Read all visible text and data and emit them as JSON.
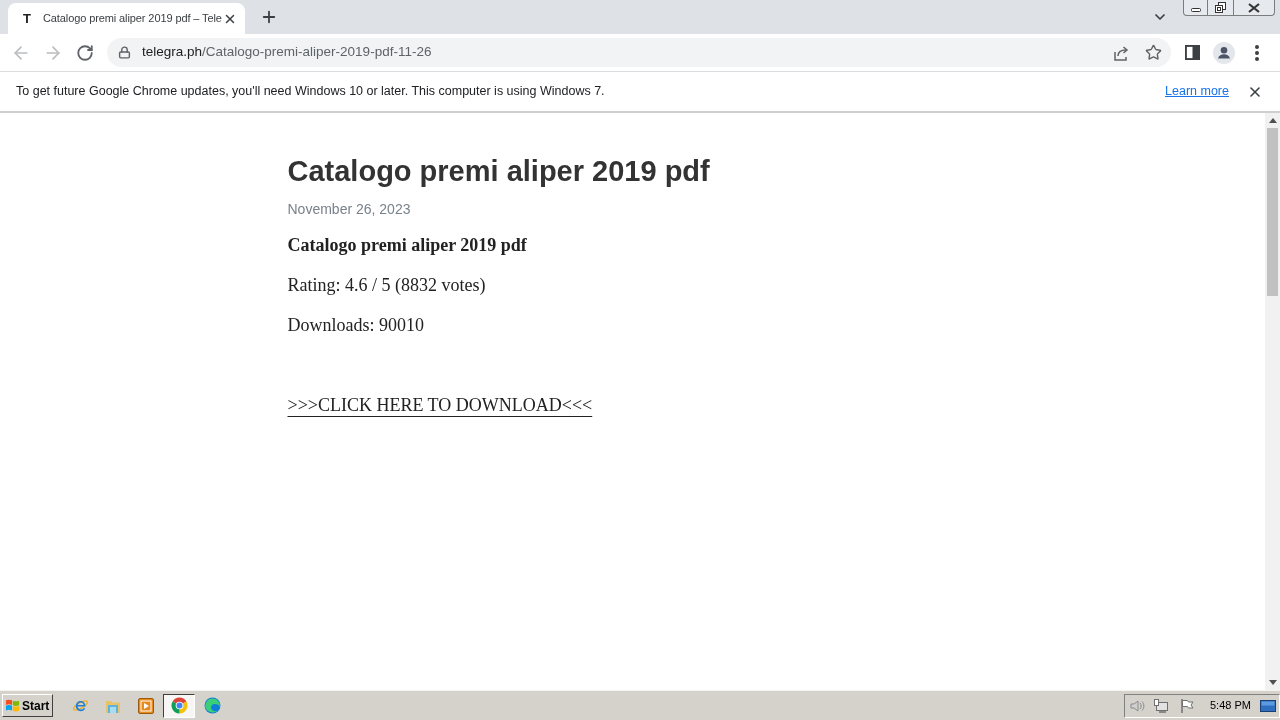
{
  "browser": {
    "tabs": [
      {
        "favicon": "T",
        "title": "Catalogo premi aliper 2019 pdf – Tele",
        "selected": true
      }
    ],
    "nav_buttons": [
      {
        "kind": "back",
        "disabled": true
      },
      {
        "kind": "forward",
        "disabled": true
      },
      {
        "kind": "reload",
        "disabled": false
      }
    ],
    "address_bar": {
      "host": "telegra.ph",
      "path": "/Catalogo-premi-aliper-2019-pdf-11-26"
    }
  },
  "infobar": {
    "message": "To get future Google Chrome updates, you'll need Windows 10 or later. This computer is using Windows 7.",
    "link": "Learn more"
  },
  "article": {
    "title": "Catalogo premi aliper 2019 pdf",
    "date": "November 26, 2023",
    "paragraphs": [
      {
        "kind": "bold",
        "text": "Catalogo premi aliper 2019 pdf"
      },
      {
        "kind": "plain",
        "text": "Rating: 4.6 / 5 (8832 votes)"
      },
      {
        "kind": "plain",
        "text": "Downloads: 90010"
      },
      {
        "kind": "link",
        "text": ">>>CLICK HERE TO DOWNLOAD<<<"
      }
    ]
  },
  "taskbar": {
    "start": "Start",
    "apps": [
      {
        "kind": "e_logo",
        "selected": false
      },
      {
        "kind": "folder",
        "selected": false
      },
      {
        "kind": "player",
        "selected": false
      },
      {
        "kind": "circle_logo",
        "selected": true
      },
      {
        "kind": "swirl_logo",
        "selected": false
      }
    ],
    "clock": "5:48 PM"
  }
}
